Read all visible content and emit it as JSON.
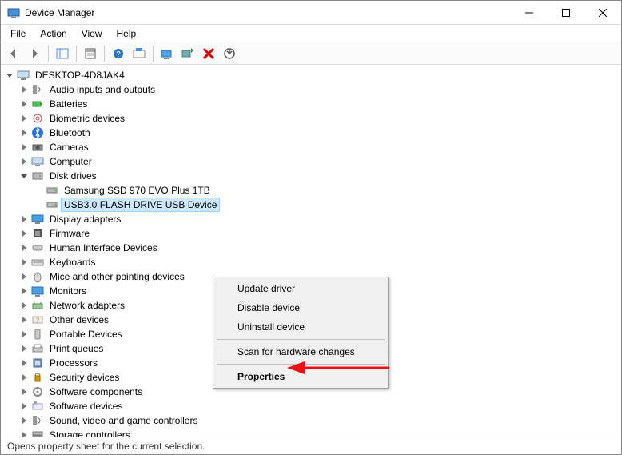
{
  "window": {
    "title": "Device Manager"
  },
  "menus": {
    "file": "File",
    "action": "Action",
    "view": "View",
    "help": "Help"
  },
  "tree": {
    "root_label": "DESKTOP-4D8JAK4",
    "items": [
      {
        "label": "Audio inputs and outputs",
        "expanded": false
      },
      {
        "label": "Batteries",
        "expanded": false
      },
      {
        "label": "Biometric devices",
        "expanded": false
      },
      {
        "label": "Bluetooth",
        "expanded": false
      },
      {
        "label": "Cameras",
        "expanded": false
      },
      {
        "label": "Computer",
        "expanded": false
      },
      {
        "label": "Disk drives",
        "expanded": true,
        "children": [
          {
            "label": "Samsung SSD 970 EVO Plus 1TB",
            "selected": false
          },
          {
            "label": "USB3.0 FLASH DRIVE USB Device",
            "selected": true
          }
        ]
      },
      {
        "label": "Display adapters",
        "expanded": false
      },
      {
        "label": "Firmware",
        "expanded": false
      },
      {
        "label": "Human Interface Devices",
        "expanded": false
      },
      {
        "label": "Keyboards",
        "expanded": false
      },
      {
        "label": "Mice and other pointing devices",
        "expanded": false
      },
      {
        "label": "Monitors",
        "expanded": false
      },
      {
        "label": "Network adapters",
        "expanded": false
      },
      {
        "label": "Other devices",
        "expanded": false
      },
      {
        "label": "Portable Devices",
        "expanded": false
      },
      {
        "label": "Print queues",
        "expanded": false
      },
      {
        "label": "Processors",
        "expanded": false
      },
      {
        "label": "Security devices",
        "expanded": false
      },
      {
        "label": "Software components",
        "expanded": false
      },
      {
        "label": "Software devices",
        "expanded": false
      },
      {
        "label": "Sound, video and game controllers",
        "expanded": false
      },
      {
        "label": "Storage controllers",
        "expanded": false
      }
    ]
  },
  "ctxmenu": {
    "update": "Update driver",
    "disable": "Disable device",
    "uninstall": "Uninstall device",
    "scan": "Scan for hardware changes",
    "properties": "Properties"
  },
  "statusbar": {
    "text": "Opens property sheet for the current selection."
  }
}
